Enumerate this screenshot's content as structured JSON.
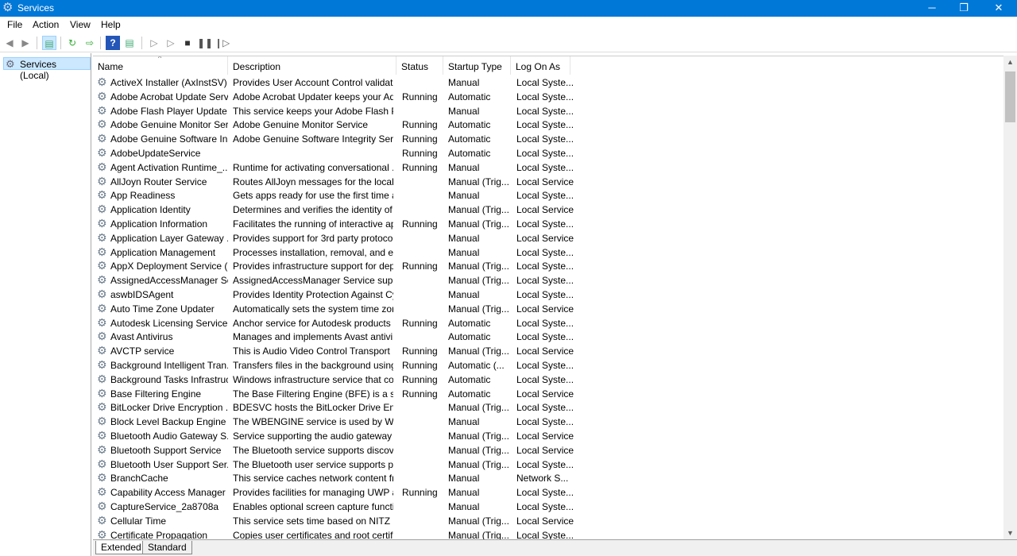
{
  "window": {
    "title": "Services",
    "minimize": "─",
    "restore": "❐",
    "close": "✕"
  },
  "menu": [
    "File",
    "Action",
    "View",
    "Help"
  ],
  "tree": {
    "node": "Services (Local)"
  },
  "columns": [
    "Name",
    "Description",
    "Status",
    "Startup Type",
    "Log On As"
  ],
  "rows": [
    [
      "ActiveX Installer (AxInstSV)",
      "Provides User Account Control validati...",
      "",
      "Manual",
      "Local Syste..."
    ],
    [
      "Adobe Acrobat Update Serv...",
      "Adobe Acrobat Updater keeps your Ad...",
      "Running",
      "Automatic",
      "Local Syste..."
    ],
    [
      "Adobe Flash Player Update ...",
      "This service keeps your Adobe Flash Pl...",
      "",
      "Manual",
      "Local Syste..."
    ],
    [
      "Adobe Genuine Monitor Ser...",
      "Adobe Genuine Monitor Service",
      "Running",
      "Automatic",
      "Local Syste..."
    ],
    [
      "Adobe Genuine Software In...",
      "Adobe Genuine Software Integrity Servi...",
      "Running",
      "Automatic",
      "Local Syste..."
    ],
    [
      "AdobeUpdateService",
      "",
      "Running",
      "Automatic",
      "Local Syste..."
    ],
    [
      "Agent Activation Runtime_...",
      "Runtime for activating conversational ...",
      "Running",
      "Manual",
      "Local Syste..."
    ],
    [
      "AllJoyn Router Service",
      "Routes AllJoyn messages for the local ...",
      "",
      "Manual (Trig...",
      "Local Service"
    ],
    [
      "App Readiness",
      "Gets apps ready for use the first time a ...",
      "",
      "Manual",
      "Local Syste..."
    ],
    [
      "Application Identity",
      "Determines and verifies the identity of ...",
      "",
      "Manual (Trig...",
      "Local Service"
    ],
    [
      "Application Information",
      "Facilitates the running of interactive ap...",
      "Running",
      "Manual (Trig...",
      "Local Syste..."
    ],
    [
      "Application Layer Gateway ...",
      "Provides support for 3rd party protocol...",
      "",
      "Manual",
      "Local Service"
    ],
    [
      "Application Management",
      "Processes installation, removal, and en...",
      "",
      "Manual",
      "Local Syste..."
    ],
    [
      "AppX Deployment Service (...",
      "Provides infrastructure support for dep...",
      "Running",
      "Manual (Trig...",
      "Local Syste..."
    ],
    [
      "AssignedAccessManager Se...",
      "AssignedAccessManager Service supp...",
      "",
      "Manual (Trig...",
      "Local Syste..."
    ],
    [
      "aswbIDSAgent",
      "Provides Identity Protection Against Cy...",
      "",
      "Manual",
      "Local Syste..."
    ],
    [
      "Auto Time Zone Updater",
      "Automatically sets the system time zone.",
      "",
      "Manual (Trig...",
      "Local Service"
    ],
    [
      "Autodesk Licensing Service",
      "Anchor service for Autodesk products l...",
      "Running",
      "Automatic",
      "Local Syste..."
    ],
    [
      "Avast Antivirus",
      "Manages and implements Avast antivir...",
      "",
      "Automatic",
      "Local Syste..."
    ],
    [
      "AVCTP service",
      "This is Audio Video Control Transport P...",
      "Running",
      "Manual (Trig...",
      "Local Service"
    ],
    [
      "Background Intelligent Tran...",
      "Transfers files in the background using ...",
      "Running",
      "Automatic (...",
      "Local Syste..."
    ],
    [
      "Background Tasks Infrastruc...",
      "Windows infrastructure service that co...",
      "Running",
      "Automatic",
      "Local Syste..."
    ],
    [
      "Base Filtering Engine",
      "The Base Filtering Engine (BFE) is a serv...",
      "Running",
      "Automatic",
      "Local Service"
    ],
    [
      "BitLocker Drive Encryption ...",
      "BDESVC hosts the BitLocker Drive Encr...",
      "",
      "Manual (Trig...",
      "Local Syste..."
    ],
    [
      "Block Level Backup Engine ...",
      "The WBENGINE service is used by Wind...",
      "",
      "Manual",
      "Local Syste..."
    ],
    [
      "Bluetooth Audio Gateway S...",
      "Service supporting the audio gateway r...",
      "",
      "Manual (Trig...",
      "Local Service"
    ],
    [
      "Bluetooth Support Service",
      "The Bluetooth service supports discove...",
      "",
      "Manual (Trig...",
      "Local Service"
    ],
    [
      "Bluetooth User Support Ser...",
      "The Bluetooth user service supports pr...",
      "",
      "Manual (Trig...",
      "Local Syste..."
    ],
    [
      "BranchCache",
      "This service caches network content fr...",
      "",
      "Manual",
      "Network S..."
    ],
    [
      "Capability Access Manager ...",
      "Provides facilities for managing UWP a...",
      "Running",
      "Manual",
      "Local Syste..."
    ],
    [
      "CaptureService_2a8708a",
      "Enables optional screen capture functi...",
      "",
      "Manual",
      "Local Syste..."
    ],
    [
      "Cellular Time",
      "This service sets time based on NITZ m...",
      "",
      "Manual (Trig...",
      "Local Service"
    ],
    [
      "Certificate Propagation",
      "Copies user certificates and root certifi...",
      "",
      "Manual (Trig...",
      "Local Syste..."
    ]
  ],
  "tabs": [
    "Extended",
    "Standard"
  ]
}
